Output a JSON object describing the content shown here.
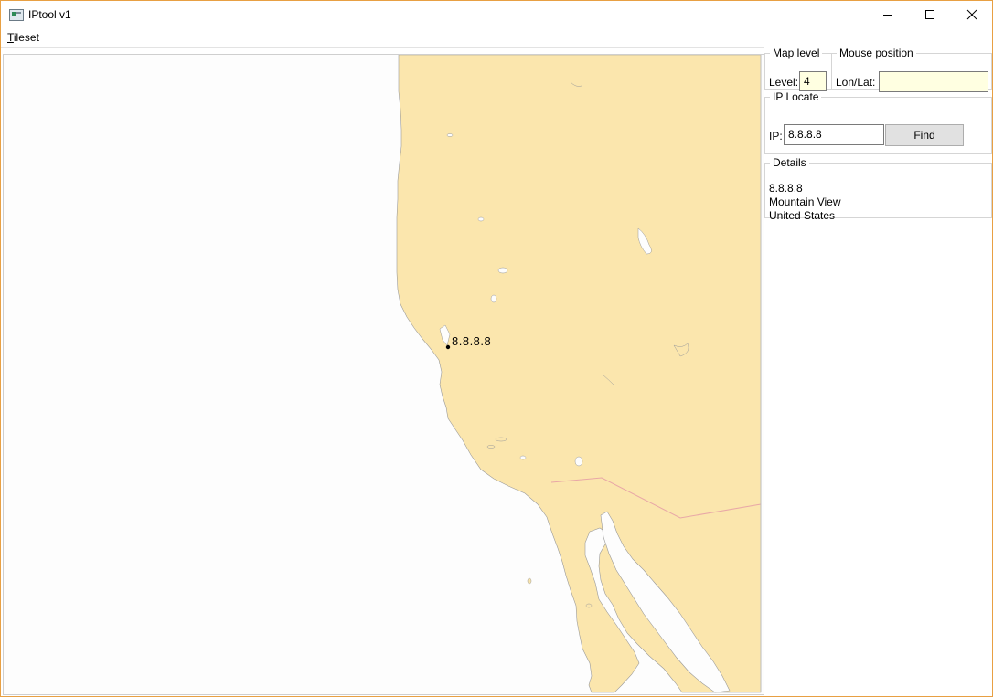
{
  "window": {
    "title": "IPtool v1",
    "controls": {
      "minimize_icon": "minimize-icon",
      "maximize_icon": "maximize-icon",
      "close_icon": "close-icon"
    },
    "accent_color": "#e8a043"
  },
  "menu": {
    "tileset_accel": "T",
    "tileset_rest": "ileset"
  },
  "map": {
    "marker_label": "8.8.8.8",
    "land_color": "#fbe6ad",
    "border_color": "#e8a7a7",
    "water_color": "#fdfdfd"
  },
  "panel": {
    "map_level": {
      "legend": "Map level",
      "label": "Level:",
      "value": "4"
    },
    "mouse_position": {
      "legend": "Mouse position",
      "label": "Lon/Lat:",
      "value": ""
    },
    "ip_locate": {
      "legend": "IP Locate",
      "label": "IP:",
      "value": "8.8.8.8",
      "button": "Find"
    },
    "details": {
      "legend": "Details",
      "lines": [
        "8.8.8.8",
        "Mountain View",
        "United States"
      ]
    }
  }
}
